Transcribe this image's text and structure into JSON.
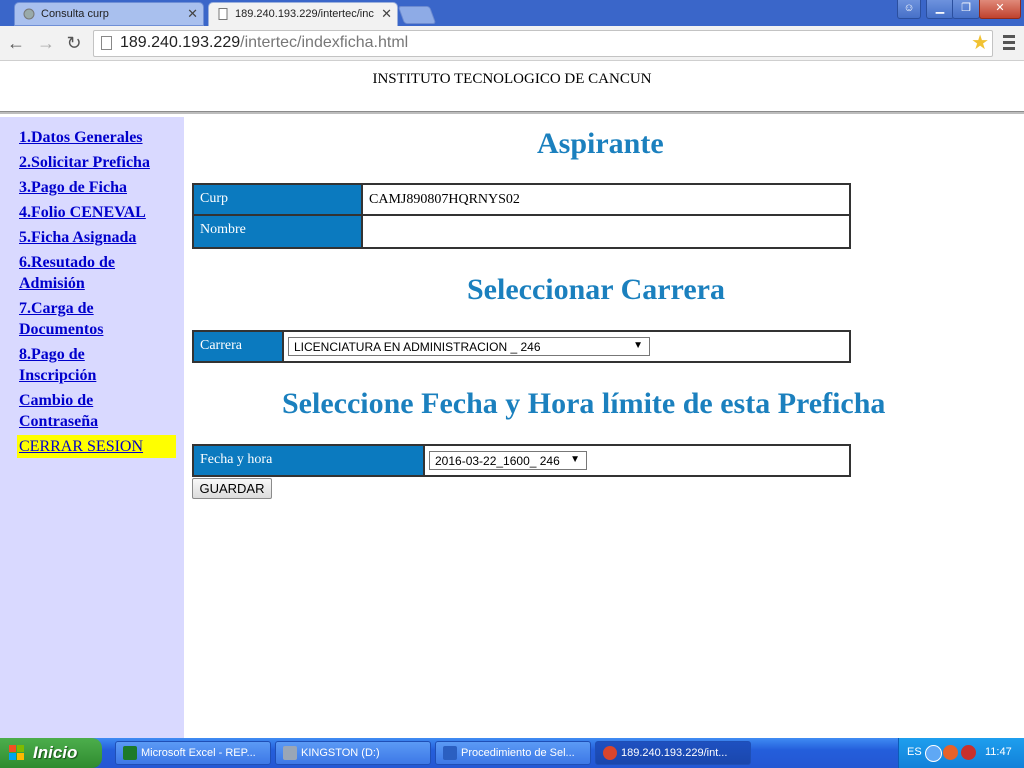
{
  "browser": {
    "tabs": [
      {
        "label": "Consulta curp",
        "active": false
      },
      {
        "label": "189.240.193.229/intertec/inc",
        "active": true
      }
    ],
    "url_host": "189.240.193.229",
    "url_path": "/intertec/indexficha.html"
  },
  "page": {
    "header_title": "INSTITUTO TECNOLOGICO DE CANCUN",
    "sidebar": {
      "items": [
        {
          "label": "1.Datos Generales"
        },
        {
          "label": "2.Solicitar Preficha"
        },
        {
          "label": "3.Pago de Ficha"
        },
        {
          "label": "4.Folio CENEVAL"
        },
        {
          "label": "5.Ficha Asignada"
        },
        {
          "label": "6.Resutado de Admisión"
        },
        {
          "label": "7.Carga de Documentos"
        },
        {
          "label": "8.Pago de Inscripción"
        },
        {
          "label": "Cambio de Contraseña"
        }
      ],
      "logout_label": "CERRAR SESION"
    },
    "aspirante": {
      "title": "Aspirante",
      "curp_label": "Curp",
      "curp_value": "CAMJ890807HQRNYS02",
      "nombre_label": "Nombre",
      "nombre_value": ""
    },
    "carrera": {
      "title": "Seleccionar Carrera",
      "label": "Carrera",
      "selected": "LICENCIATURA EN ADMINISTRACION _ 246"
    },
    "fecha": {
      "title": "Seleccione Fecha y Hora límite de esta Preficha",
      "label": "Fecha y hora",
      "selected": "2016-03-22_1600_ 246"
    },
    "save_button": "GUARDAR"
  },
  "taskbar": {
    "start_label": "Inicio",
    "tasks": [
      {
        "label": "Microsoft Excel - REP...",
        "icon": "excel-icon",
        "color": "#1d7a2a"
      },
      {
        "label": "KINGSTON (D:)",
        "icon": "drive-icon",
        "color": "#9aa6b6"
      },
      {
        "label": "Procedimiento de Sel...",
        "icon": "word-icon",
        "color": "#2b5fc1"
      },
      {
        "label": "189.240.193.229/int...",
        "icon": "chrome-icon",
        "color": "#d9452c"
      }
    ],
    "tray": {
      "lang": "ES",
      "time": "11:47"
    }
  }
}
